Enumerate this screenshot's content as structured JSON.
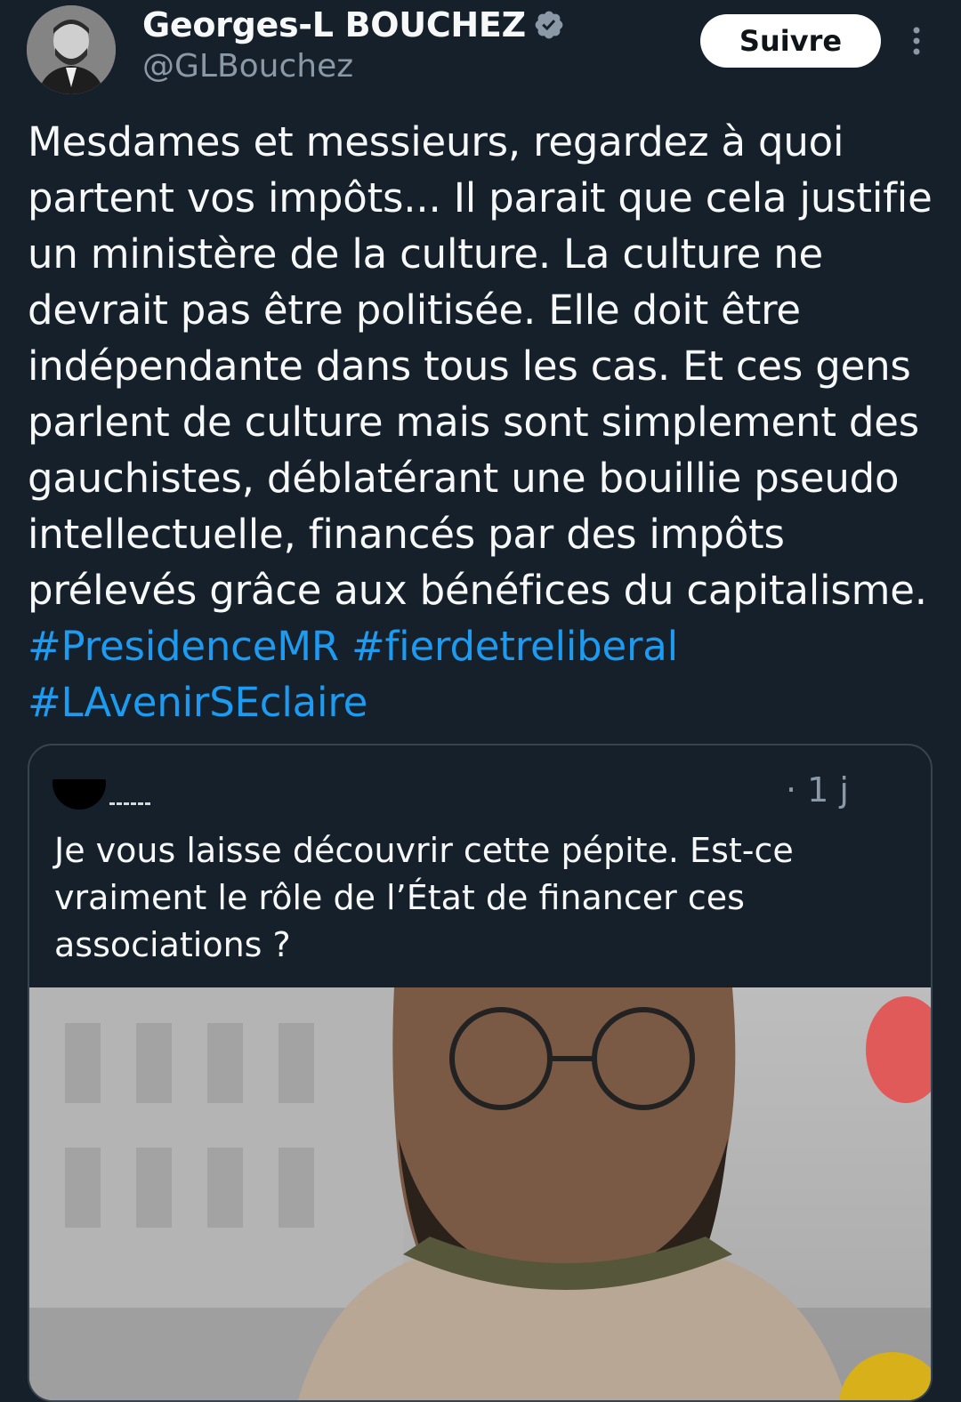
{
  "author": {
    "display_name": "Georges-L BOUCHEZ",
    "handle": "@GLBouchez",
    "verified": true,
    "avatar_icon": "profile-photo"
  },
  "follow_button": {
    "label": "Suivre"
  },
  "more_menu": {
    "icon": "vertical-ellipsis-icon"
  },
  "tweet": {
    "text": "Mesdames et messieurs, regardez à quoi partent vos impôts... Il parait que cela justifie un ministère de la culture. La culture ne devrait pas être politisée. Elle doit être indépendante dans tous les cas. Et ces gens parlent de culture mais sont simplement des gauchistes, déblatérant une bouillie pseudo intellectuelle, financés par des impôts prélevés grâce aux bénéfices du capitalisme.",
    "hashtags": [
      "#PresidenceMR",
      "#fierdetreliberal",
      "#LAvenirSEclaire"
    ]
  },
  "quoted_tweet": {
    "time": "· 1 j",
    "text": "Je vous laisse découvrir cette pépite. Est-ce vraiment le rôle de l’État de financer ces associations ?",
    "media_icon": "video-thumbnail"
  },
  "colors": {
    "background": "#15202b",
    "text": "#f7f9f9",
    "secondary_text": "#8b98a5",
    "link": "#1d9bf0",
    "verified": "#8b98a5",
    "border": "#38444d"
  }
}
